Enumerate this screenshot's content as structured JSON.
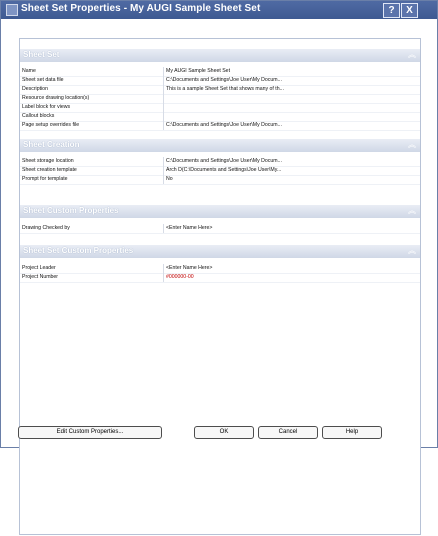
{
  "window": {
    "title": "Sheet Set Properties - My AUGI Sample Sheet Set",
    "help_button": "?",
    "close_button": "X"
  },
  "sections": [
    {
      "title": "Sheet Set",
      "rows": [
        {
          "name": "Name",
          "value": "My AUGI Sample Sheet Set"
        },
        {
          "name": "Sheet set data file",
          "value": "C:\\Documents and Settings\\Joe User\\My Docum..."
        },
        {
          "name": "Description",
          "value": "This is a sample Sheet Set that shows many of th..."
        },
        {
          "name": "Resource drawing location(s)",
          "value": ""
        },
        {
          "name": "Label block for views",
          "value": ""
        },
        {
          "name": "Callout blocks",
          "value": ""
        },
        {
          "name": "Page setup overrides file",
          "value": "C:\\Documents and Settings\\Joe User\\My Docum..."
        }
      ]
    },
    {
      "title": "Sheet Creation",
      "rows": [
        {
          "name": "Sheet storage location",
          "value": "C:\\Documents and Settings\\Joe User\\My Docum..."
        },
        {
          "name": "Sheet creation template",
          "value": "Arch D(C:\\Documents and Settings\\Joe User\\My..."
        },
        {
          "name": "Prompt for template",
          "value": "No"
        }
      ]
    },
    {
      "title": "Sheet Custom Properties",
      "rows": [
        {
          "name": "Drawing Checked by",
          "value": "<Enter Name Here>"
        }
      ]
    },
    {
      "title": "Sheet Set Custom Properties",
      "rows": [
        {
          "name": "Project Leader",
          "value": "<Enter Name Here>"
        },
        {
          "name": "Project Number",
          "value": "#000000-00"
        }
      ]
    }
  ],
  "buttons": {
    "edit_custom_properties": "Edit Custom Properties...",
    "ok": "OK",
    "cancel": "Cancel",
    "help": "Help"
  },
  "colors": {
    "title_bar": "#3e5a92",
    "section_header": "#cfd7e6",
    "highlight_value": "#c00000"
  },
  "icons": {
    "collapse": "double-chevron-up-icon"
  }
}
